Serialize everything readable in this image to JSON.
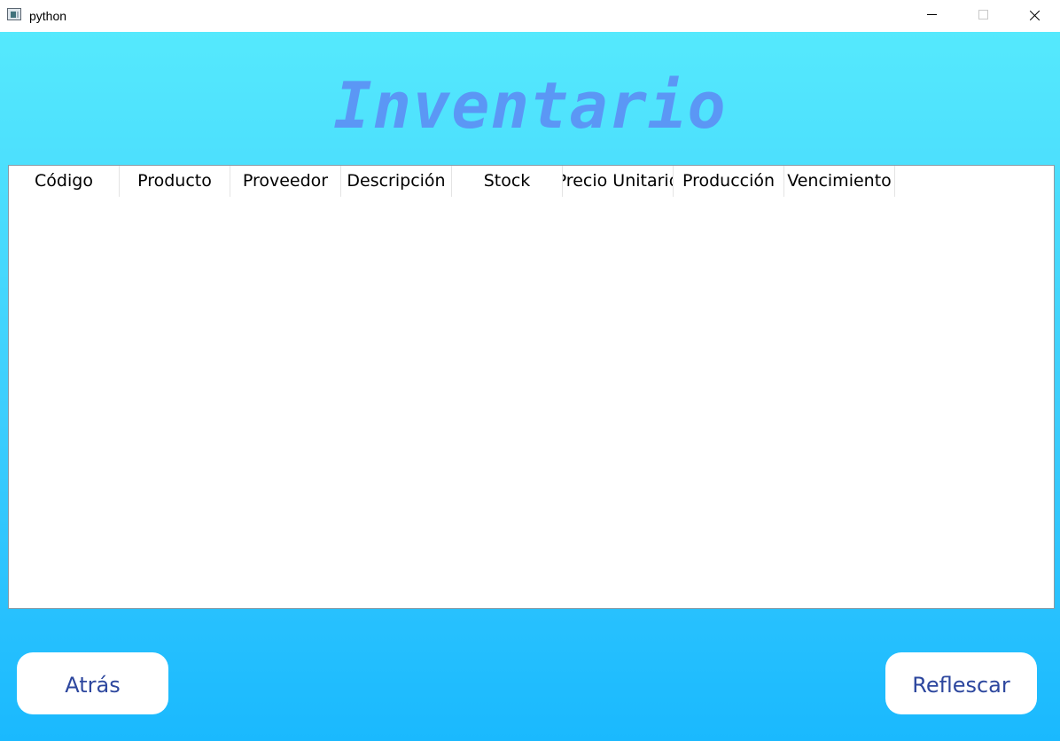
{
  "window": {
    "title": "python"
  },
  "header": {
    "title": "Inventario"
  },
  "table": {
    "columns": [
      "Código",
      "Producto",
      "Proveedor",
      "Descripción",
      "Stock",
      "Precio Unitario",
      "Producción",
      "Vencimiento"
    ],
    "rows": []
  },
  "buttons": {
    "back_label": "Atrás",
    "refresh_label": "Reflescar"
  },
  "colors": {
    "background_top": "#55e9fd",
    "background_bottom": "#1ab9fe",
    "title": "#5b97f5",
    "button_text": "#2d479e"
  },
  "icons": {
    "app": "python-window-icon",
    "minimize": "minimize-icon",
    "maximize": "maximize-icon",
    "close": "close-icon"
  }
}
